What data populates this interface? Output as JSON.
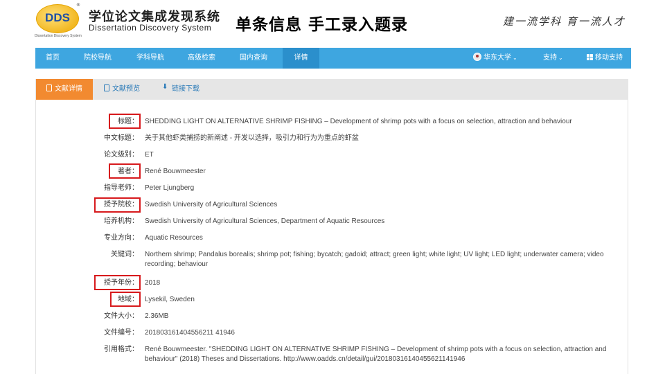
{
  "header": {
    "logo_text": "DDS",
    "logo_subtext": "Dissertation Discovery System",
    "system_name_cn": "学位论文集成发现系统",
    "system_name_en": "Dissertation Discovery System",
    "slide_title": "单条信息   手工录入题录",
    "slogan": "建一流学科  育一流人才"
  },
  "nav": {
    "items": [
      {
        "label": "首页"
      },
      {
        "label": "院校导航"
      },
      {
        "label": "学科导航"
      },
      {
        "label": "高级检索"
      },
      {
        "label": "国内查询"
      },
      {
        "label": "详情"
      }
    ],
    "user_label": "华东大学",
    "support_label": "支持",
    "mobile_label": "移动支持"
  },
  "tabs": [
    {
      "label": "文献详情",
      "icon": "document-icon"
    },
    {
      "label": "文献预览",
      "icon": "preview-icon"
    },
    {
      "label": "链接下载",
      "icon": "download-icon"
    }
  ],
  "details": [
    {
      "label": "标题：",
      "value": "SHEDDING LIGHT ON ALTERNATIVE SHRIMP FISHING – Development of shrimp pots with a focus on selection, attraction and behaviour"
    },
    {
      "label": "中文标题：",
      "value": "关于其他虾类捕捞的新阐述 - 开发以选择，吸引力和行为为重点的虾盆"
    },
    {
      "label": "论文级别：",
      "value": "ET"
    },
    {
      "label": "著者：",
      "value": "René Bouwmeester"
    },
    {
      "label": "指导老师：",
      "value": "Peter Ljungberg"
    },
    {
      "label": "授予院校：",
      "value": "Swedish University of Agricultural Sciences"
    },
    {
      "label": "培养机构：",
      "value": "Swedish University of Agricultural Sciences, Department of Aquatic Resources"
    },
    {
      "label": "专业方向：",
      "value": "Aquatic Resources"
    },
    {
      "label": "关键词：",
      "value": "Northern shrimp; Pandalus borealis; shrimp pot; fishing; bycatch; gadoid; attract; green light; white light; UV light; LED light; underwater camera; video recording; behaviour"
    },
    {
      "label": "授予年份：",
      "value": "2018"
    },
    {
      "label": "地域：",
      "value": "Lysekil, Sweden"
    },
    {
      "label": "文件大小：",
      "value": "2.36MB"
    },
    {
      "label": "文件编号：",
      "value": "201803161404556211 41946"
    },
    {
      "label": "引用格式：",
      "value": "René Bouwmeester. \"SHEDDING LIGHT ON ALTERNATIVE SHRIMP FISHING – Development of shrimp pots with a focus on selection, attraction and behaviour\" (2018) Theses and Dissertations. http://www.oadds.cn/detail/gui/20180316140455621141946"
    }
  ],
  "colors": {
    "nav": "#3ea6e0",
    "active_tab": "#f28a30",
    "highlight": "#d7191c"
  }
}
